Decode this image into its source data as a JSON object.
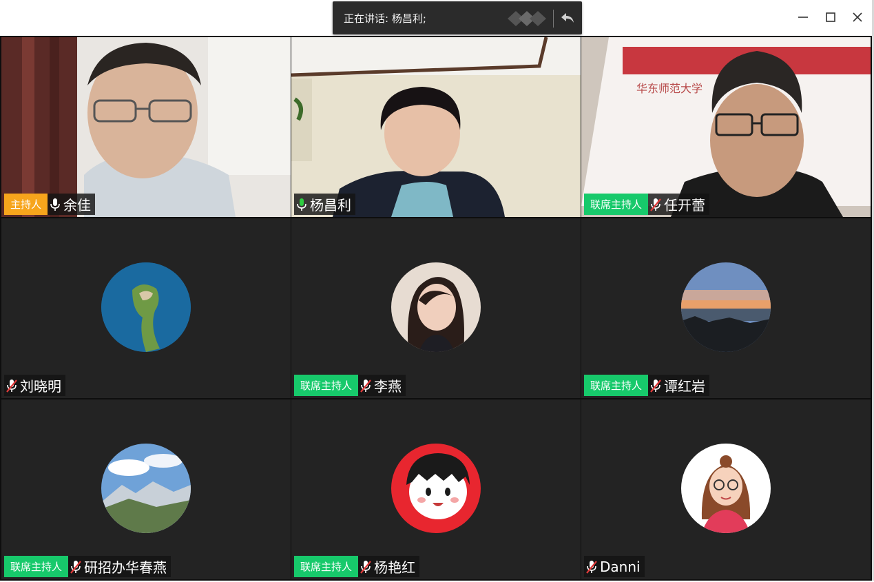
{
  "speaking_bar": {
    "text": "正在讲话: 杨昌利;",
    "logo_icon": "meeting-logo-icon",
    "restore_icon": "return-arrow-icon"
  },
  "window_controls": {
    "minimize_icon": "minimize-icon",
    "maximize_icon": "maximize-icon",
    "close_icon": "close-icon"
  },
  "colors": {
    "host_badge": "#f7a51c",
    "cohost_badge": "#17c96b",
    "tile_background": "#232323",
    "active_border": "#2f8cff"
  },
  "participants": [
    {
      "name": "余佳",
      "role": "主持人",
      "mic": "on",
      "media": "video"
    },
    {
      "name": "杨昌利",
      "role": "",
      "mic": "on",
      "media": "video",
      "speaking": true
    },
    {
      "name": "任开蕾",
      "role": "联席主持人",
      "mic": "muted",
      "media": "video"
    },
    {
      "name": "刘晓明",
      "role": "",
      "mic": "muted",
      "media": "avatar",
      "avatar": "island-avatar"
    },
    {
      "name": "李燕",
      "role": "联席主持人",
      "mic": "muted",
      "media": "avatar",
      "avatar": "woman-photo-avatar"
    },
    {
      "name": "谭红岩",
      "role": "联席主持人",
      "mic": "muted",
      "media": "avatar",
      "avatar": "sunset-avatar"
    },
    {
      "name": "研招办华春燕",
      "role": "联席主持人",
      "mic": "muted",
      "media": "avatar",
      "avatar": "mountain-avatar"
    },
    {
      "name": "杨艳红",
      "role": "联席主持人",
      "mic": "muted",
      "media": "avatar",
      "avatar": "cartoon-girl-avatar"
    },
    {
      "name": "Danni",
      "role": "",
      "mic": "muted",
      "media": "avatar",
      "avatar": "cartoon-woman-avatar"
    }
  ]
}
